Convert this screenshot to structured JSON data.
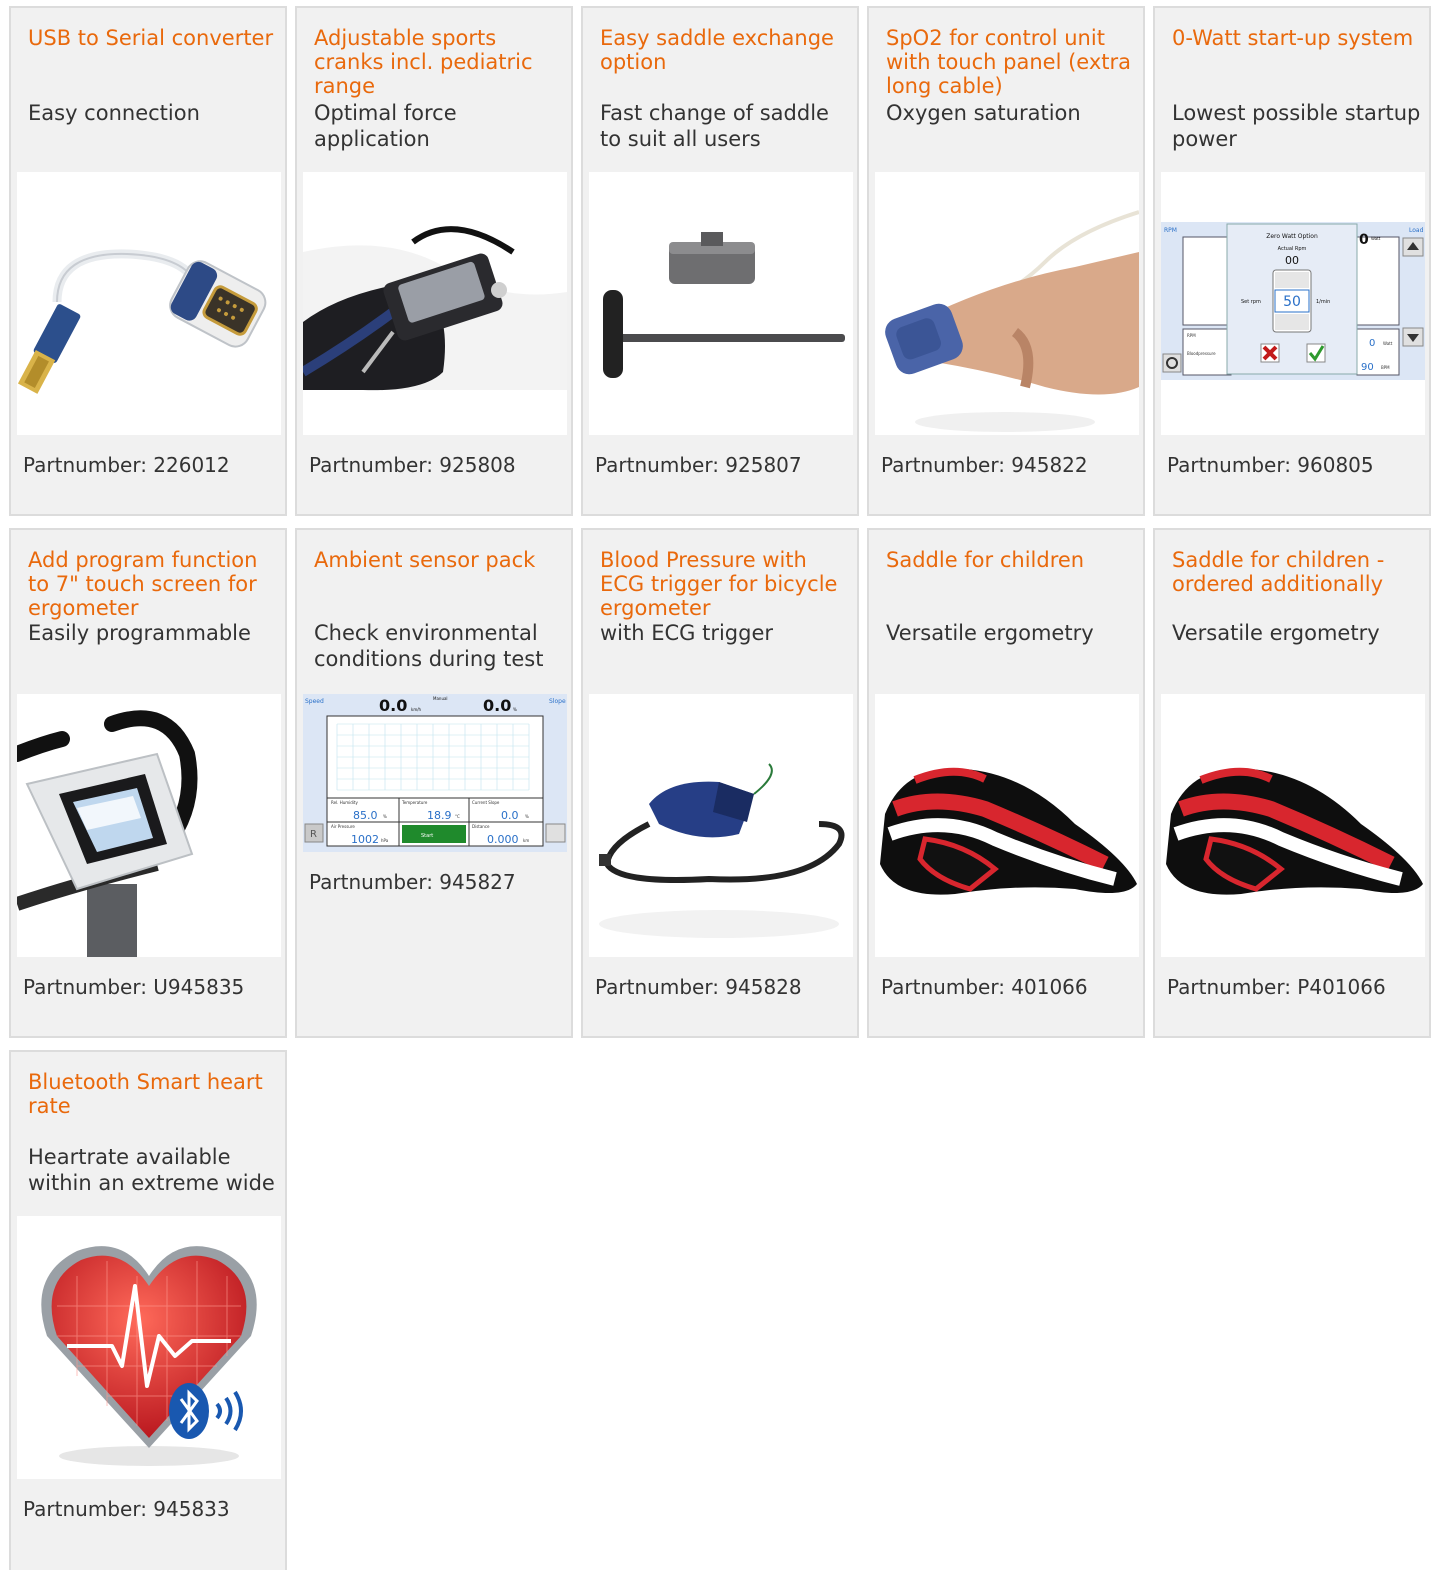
{
  "products": [
    {
      "title": "USB to Serial converter",
      "description": "Easy connection",
      "partnumber": "Partnumber: 226012"
    },
    {
      "title": "Adjustable sports cranks incl. pediatric range",
      "description": "Optimal force application",
      "partnumber": "Partnumber: 925808"
    },
    {
      "title": "Easy saddle exchange option",
      "description": "Fast change of saddle to suit all users",
      "partnumber": "Partnumber: 925807"
    },
    {
      "title": "SpO2 for control unit with touch panel (extra long cable)",
      "description": "Oxygen saturation",
      "partnumber": "Partnumber: 945822"
    },
    {
      "title": "0-Watt start-up system",
      "description": "Lowest possible startup power",
      "partnumber": "Partnumber: 960805"
    },
    {
      "title": "Add program function to 7\" touch screen for ergometer",
      "description": "Easily programmable",
      "partnumber": "Partnumber: U945835"
    },
    {
      "title": "Ambient sensor pack",
      "description": "Check environmental conditions during test",
      "partnumber": "Partnumber: 945827"
    },
    {
      "title": "Blood Pressure with ECG trigger for bicycle ergometer",
      "description": "with ECG trigger",
      "partnumber": "Partnumber: 945828"
    },
    {
      "title": "Saddle for children",
      "description": "Versatile ergometry",
      "partnumber": "Partnumber: 401066"
    },
    {
      "title": "Saddle for children - ordered additionally",
      "description": "Versatile ergometry",
      "partnumber": "Partnumber: P401066"
    },
    {
      "title": "Bluetooth Smart heart rate",
      "description": "Heartrate available within an extreme wide",
      "partnumber": "Partnumber: 945833"
    }
  ],
  "screens": {
    "zero_watt": {
      "rpm_label": "RPM",
      "load_label": "Load",
      "dialog_title": "Zero Watt Option",
      "actual_rpm_label": "Actual Rpm",
      "actual_rpm_value": "00",
      "set_rpm_label": "Set rpm",
      "set_rpm_value": "50",
      "unit": "1/min",
      "watt_value": "0",
      "watt_unit": "Watt",
      "bpm_value": "90",
      "bpm_unit": "BPM",
      "rpm_small": "RPM",
      "bp_label": "Bloodpressure",
      "big_value": "0",
      "big_unit": "Watt"
    },
    "ambient": {
      "speed_label": "Speed",
      "manual_label": "Manual",
      "slope_label": "Slope",
      "speed_value": "0.0",
      "speed_unit": "km/h",
      "slope_value": "0.0",
      "slope_unit": "%",
      "humidity_label": "Rel. Humidity",
      "humidity_value": "85.0",
      "humidity_unit": "%",
      "temp_label": "Temperature",
      "temp_value": "18.9",
      "temp_unit": "°C",
      "cur_slope_label": "Current Slope",
      "cur_slope_value": "0.0",
      "cur_slope_unit": "%",
      "pressure_label": "Air Pressure",
      "pressure_value": "1002",
      "pressure_unit": "hPa",
      "start_label": "Start",
      "distance_label": "Distance",
      "distance_value": "0.000",
      "distance_unit": "km",
      "r_label": "R"
    }
  }
}
